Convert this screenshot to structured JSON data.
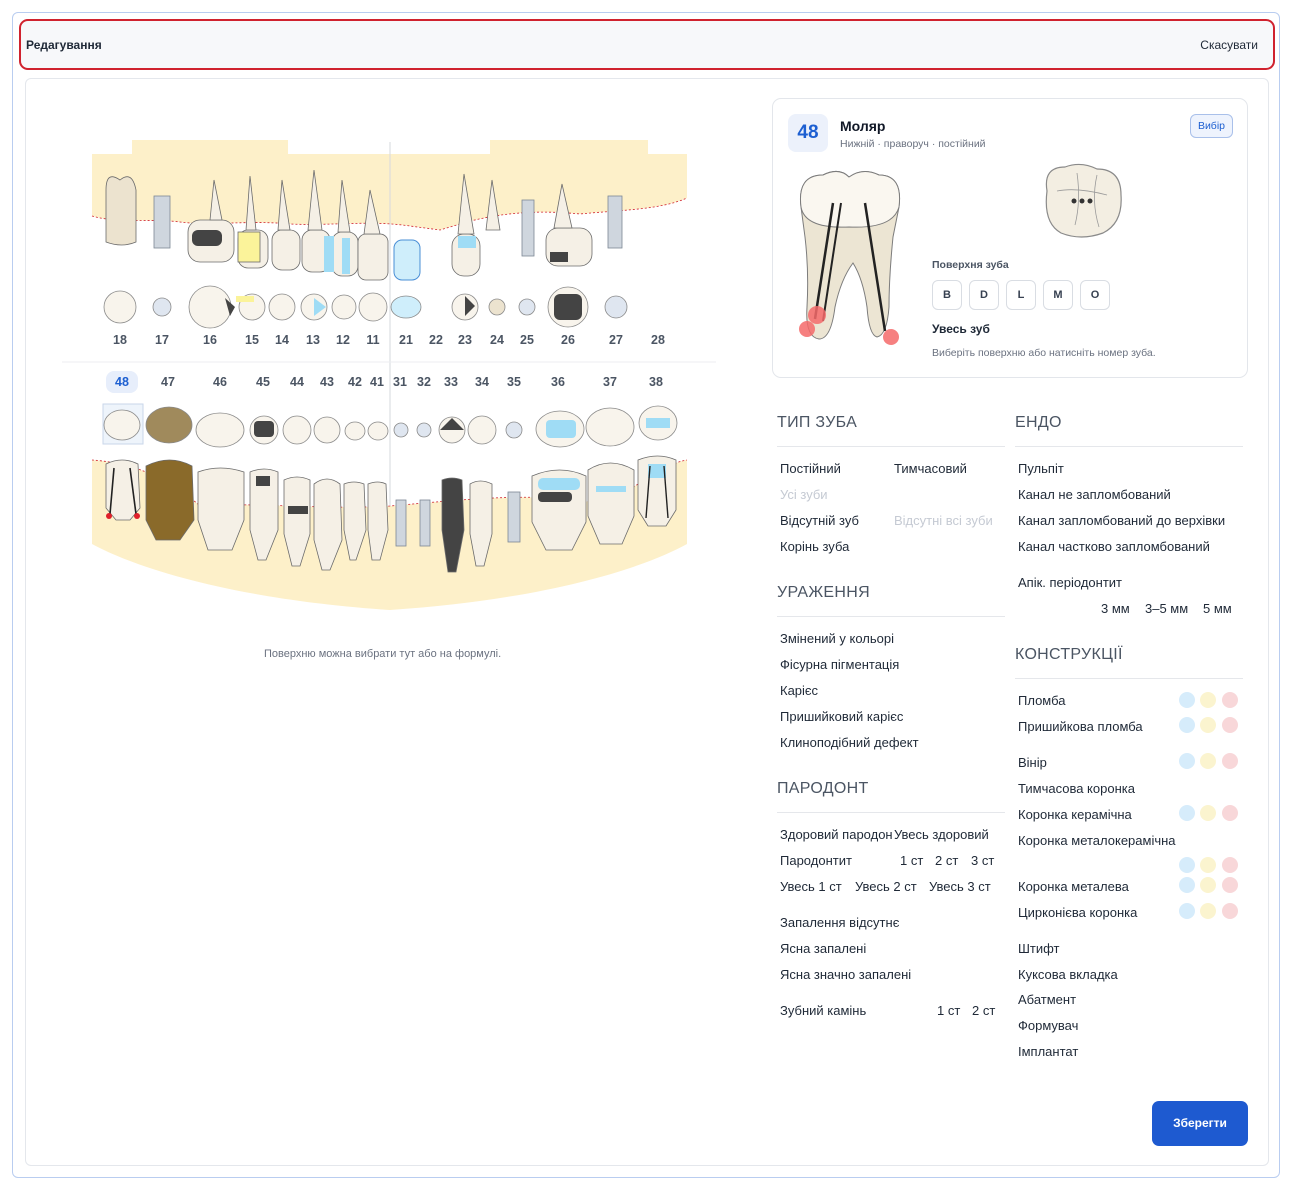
{
  "header": {
    "title": "Редагування",
    "cancel": "Скасувати"
  },
  "chart": {
    "upper_numbers": [
      "18",
      "17",
      "16",
      "15",
      "14",
      "13",
      "12",
      "11",
      "21",
      "22",
      "23",
      "24",
      "25",
      "26",
      "27",
      "28"
    ],
    "lower_numbers": [
      "48",
      "47",
      "46",
      "45",
      "44",
      "43",
      "42",
      "41",
      "31",
      "32",
      "33",
      "34",
      "35",
      "36",
      "37",
      "38"
    ],
    "selected_tooth": "48",
    "caption": "Поверхню можна вибрати тут або на формулі."
  },
  "tooth_card": {
    "number": "48",
    "name": "Моляр",
    "subtitle": "Нижній · праворуч · постійний",
    "pick_button": "Вибір",
    "surface_label": "Поверхня зуба",
    "surfaces": [
      "B",
      "D",
      "L",
      "M",
      "O"
    ],
    "whole_tooth": "Увесь зуб",
    "hint": "Виберіть поверхню або натисніть номер зуба."
  },
  "type": {
    "title": "ТИП ЗУБА",
    "permanent": "Постійний",
    "temporary": "Тимчасовий",
    "all_teeth": "Усі зуби",
    "missing": "Відсутній зуб",
    "all_missing": "Відсутні всі зуби",
    "root": "Корінь зуба"
  },
  "lesions": {
    "title": "УРАЖЕННЯ",
    "items": [
      "Змінений у кольорі",
      "Фісурна пігментація",
      "Карієс",
      "Пришийковий карієс",
      "Клиноподібний дефект"
    ]
  },
  "periodont": {
    "title": "ПАРОДОНТ",
    "healthy": "Здоровий пародонт",
    "all_healthy": "Увесь здоровий",
    "periodontitis": "Пародонтит",
    "st1": "1 ст",
    "st2": "2 ст",
    "st3": "3 ст",
    "all1": "Увесь 1 ст",
    "all2": "Увесь 2 ст",
    "all3": "Увесь 3 ст",
    "no_inflammation": "Запалення відсутнє",
    "gums_inflamed": "Ясна запалені",
    "gums_very": "Ясна значно запалені",
    "calculus": "Зубний камінь",
    "c1": "1 ст",
    "c2": "2 ст"
  },
  "endo": {
    "title": "ЕНДО",
    "items": [
      "Пульпіт",
      "Канал не запломбований",
      "Канал запломбований до верхівки",
      "Канал частково запломбований"
    ],
    "apical": "Апік. періодонтит",
    "sizes": [
      "3 мм",
      "3–5 мм",
      "5 мм"
    ]
  },
  "constructions": {
    "title": "КОНСТРУКЦІЇ",
    "filling": "Пломба",
    "cervical_filling": "Пришийкова пломба",
    "veneer": "Вінір",
    "temp_crown": "Тимчасова коронка",
    "ceramic_crown": "Коронка керамічна",
    "mc_crown": "Коронка металокерамічна",
    "metal_crown": "Коронка металева",
    "zirc_crown": "Цирконієва коронка",
    "post": "Штифт",
    "core_inlay": "Куксова вкладка",
    "abutment": "Абатмент",
    "former": "Формувач",
    "implant": "Імплантат"
  },
  "colors": {
    "dot_blue": "#d6ecfb",
    "dot_yellow": "#fbf4cf",
    "dot_red": "#f8d7d9",
    "accent": "#1e5ad0"
  },
  "save": "Зберегти"
}
